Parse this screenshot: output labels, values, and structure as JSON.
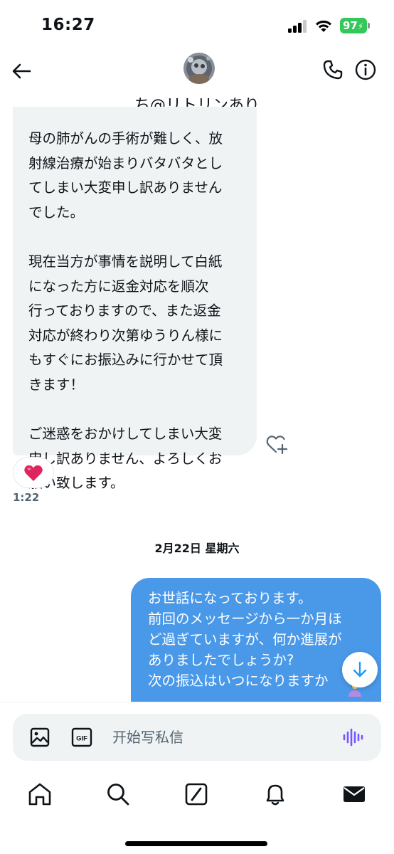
{
  "status_bar": {
    "time": "16:27",
    "battery_level": "97",
    "signal_bars_active": 3,
    "battery_color": "#34c759"
  },
  "header": {
    "title": "ち@リトリンあり",
    "back_icon": "arrow-left-icon",
    "call_icon": "phone-icon",
    "info_icon": "info-icon"
  },
  "messages": {
    "received": {
      "lines": [
        "母の肺がんの手術が難しく、放",
        "射線治療が始まりバタバタとし",
        "てしまい大変申し訳ありません",
        "でした。",
        "",
        "現在当方が事情を説明して白紙",
        "になった方に返金対応を順次",
        "行っておりますので、また返金",
        "対応が終わり次第ゆうりん様に",
        "もすぐにお振込みに行かせて頂",
        "きます！",
        "",
        "ご迷惑をおかけしてしまい大変",
        "申し訳ありません、よろしくお",
        "願い致します。"
      ],
      "reaction": "❤️",
      "time": "1:22"
    },
    "date_divider": "2月22日 星期六",
    "sent": {
      "lines": [
        "お世話になっております。",
        "前回のメッセージから一か月ほ",
        "ど過ぎていますが、何か進展が",
        "ありましたでしょうか?",
        "次の振込はいつになりますか"
      ]
    }
  },
  "composer": {
    "placeholder": "开始写私信",
    "gif_label": "GIF"
  },
  "colors": {
    "sent_bubble": "#4a99e9",
    "received_bubble": "#eff3f4",
    "accent": "#1d9bf0",
    "voice_icon": "#7856ff"
  },
  "tabs": [
    "home-icon",
    "search-icon",
    "grok-icon",
    "notifications-icon",
    "messages-icon"
  ]
}
